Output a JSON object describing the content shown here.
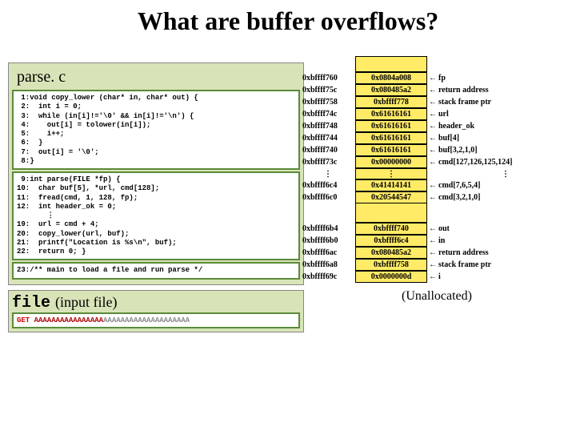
{
  "title": "What are buffer overflows?",
  "parse_label": "parse. c",
  "code_block1": [
    {
      "n": "1",
      "t": "void copy_lower (char* in, char* out) {"
    },
    {
      "n": "2",
      "t": "  int i = 0;"
    },
    {
      "n": "3",
      "t": "  while (in[i]!='\\0' && in[i]!='\\n') {"
    },
    {
      "n": "4",
      "t": "    out[i] = tolower(in[i]);"
    },
    {
      "n": "5",
      "t": "    i++;"
    },
    {
      "n": "6",
      "t": "  }"
    },
    {
      "n": "7",
      "t": "  out[i] = '\\0';"
    },
    {
      "n": "8",
      "t": "}"
    }
  ],
  "code_block2": [
    {
      "n": "9",
      "t": "int parse(FILE *fp) {"
    },
    {
      "n": "10",
      "t": "  char buf[5], *url, cmd[128];"
    },
    {
      "n": "11",
      "t": "  fread(cmd, 1, 128, fp);"
    },
    {
      "n": "12",
      "t": "  int header_ok = 0;"
    },
    {
      "n": "",
      "t": "    ⋮"
    },
    {
      "n": "19",
      "t": "  url = cmd + 4;"
    },
    {
      "n": "20",
      "t": "  copy_lower(url, buf);"
    },
    {
      "n": "21",
      "t": "  printf(\"Location is %s\\n\", buf);"
    },
    {
      "n": "22",
      "t": "  return 0; }"
    }
  ],
  "code_block3": [
    {
      "n": "23",
      "t": "/** main to load a file and run parse */"
    }
  ],
  "file_label": "file",
  "file_desc": "(input file)",
  "input_get": "GET",
  "input_a1": "AAAAAAAAAAAAAAAA",
  "input_a2": "AAAAAAAAAAAAAAAAAAAA",
  "stack": [
    {
      "addr": "0xbffff760",
      "val": "0x0804a008",
      "lbl": "fp"
    },
    {
      "addr": "0xbffff75c",
      "val": "0x080485a2",
      "lbl": "return address"
    },
    {
      "addr": "0xbffff758",
      "val": "0xbffff778",
      "lbl": "stack frame ptr"
    },
    {
      "addr": "0xbffff74c",
      "val": "0x61616161",
      "lbl": "url"
    },
    {
      "addr": "0xbffff748",
      "val": "0x61616161",
      "lbl": "header_ok"
    },
    {
      "addr": "0xbffff744",
      "val": "0x61616161",
      "lbl": "         buf[4]"
    },
    {
      "addr": "0xbffff740",
      "val": "0x61616161",
      "lbl": "buf[3,2,1,0]"
    },
    {
      "addr": "0xbffff73c",
      "val": "0x00000000",
      "lbl": "cmd[127,126,125,124]"
    },
    {
      "addr": "⋮",
      "val": "⋮",
      "lbl": "⋮",
      "dots": true
    },
    {
      "addr": "0xbffff6c4",
      "val": "0x41414141",
      "lbl": "cmd[7,6,5,4]"
    },
    {
      "addr": "0xbffff6c0",
      "val": "0x20544547",
      "lbl": "cmd[3,2,1,0]"
    },
    {
      "gap": true
    },
    {
      "addr": "0xbffff6b4",
      "val": "0xbffff740",
      "lbl": "out"
    },
    {
      "addr": "0xbffff6b0",
      "val": "0xbffff6c4",
      "lbl": "in"
    },
    {
      "addr": "0xbffff6ac",
      "val": "0x080485a2",
      "lbl": "return address"
    },
    {
      "addr": "0xbffff6a8",
      "val": "0xbffff758",
      "lbl": "stack frame ptr"
    },
    {
      "addr": "0xbffff69c",
      "val": "0x0000000d",
      "lbl": "i"
    }
  ],
  "unallocated": "(Unallocated)"
}
